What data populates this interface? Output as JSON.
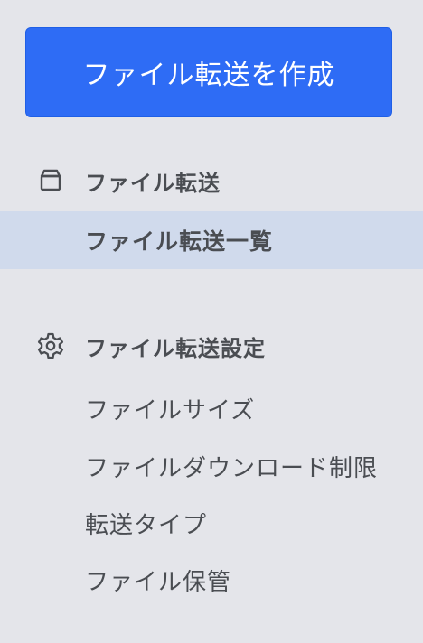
{
  "create_button": {
    "label": "ファイル転送を作成"
  },
  "sections": [
    {
      "icon": "box-icon",
      "title": "ファイル転送",
      "items": [
        {
          "label": "ファイル転送一覧",
          "active": true
        }
      ]
    },
    {
      "icon": "gear-icon",
      "title": "ファイル転送設定",
      "items": [
        {
          "label": "ファイルサイズ",
          "active": false
        },
        {
          "label": "ファイルダウンロード制限",
          "active": false
        },
        {
          "label": "転送タイプ",
          "active": false
        },
        {
          "label": "ファイル保管",
          "active": false
        }
      ]
    }
  ],
  "colors": {
    "background": "#e4e5ea",
    "accent": "#2e6cf5",
    "active_item_bg": "#d0daec",
    "text": "#4a4d52"
  }
}
